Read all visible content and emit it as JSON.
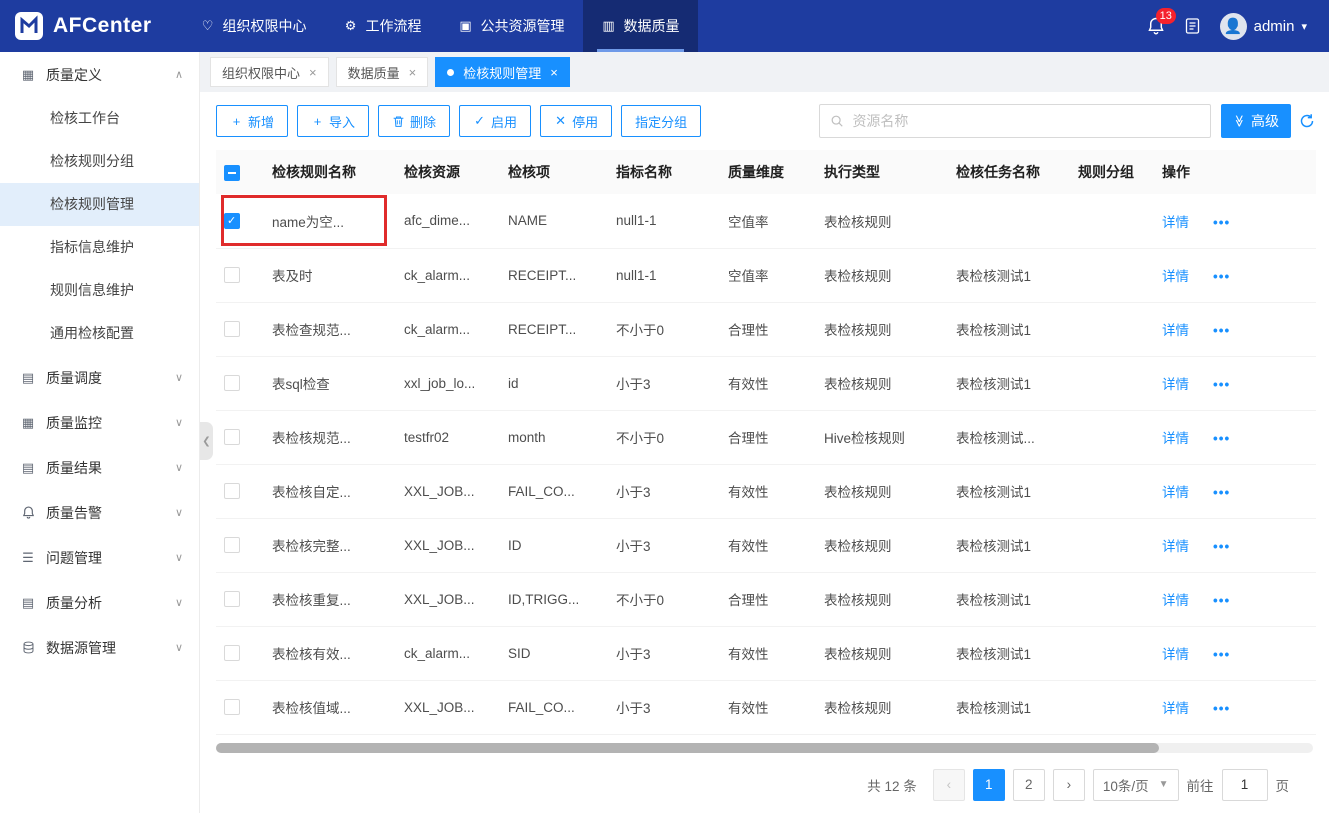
{
  "topbar": {
    "logo_text": "AFCenter",
    "nav_items": [
      {
        "label": "组织权限中心",
        "icon": "heart-icon",
        "active": false
      },
      {
        "label": "工作流程",
        "icon": "workflow-icon",
        "active": false
      },
      {
        "label": "公共资源管理",
        "icon": "resource-icon",
        "active": false
      },
      {
        "label": "数据质量",
        "icon": "chart-icon",
        "active": true
      }
    ],
    "notification_count": "13",
    "user_name": "admin"
  },
  "sidebar": {
    "groups": [
      {
        "label": "质量定义",
        "icon": "grid-icon",
        "expanded": true,
        "children": [
          {
            "label": "检核工作台",
            "active": false
          },
          {
            "label": "检核规则分组",
            "active": false
          },
          {
            "label": "检核规则管理",
            "active": true
          },
          {
            "label": "指标信息维护",
            "active": false
          },
          {
            "label": "规则信息维护",
            "active": false
          },
          {
            "label": "通用检核配置",
            "active": false
          }
        ]
      },
      {
        "label": "质量调度",
        "icon": "doc-icon",
        "expanded": false,
        "children": []
      },
      {
        "label": "质量监控",
        "icon": "grid-icon",
        "expanded": false,
        "children": []
      },
      {
        "label": "质量结果",
        "icon": "doc-icon",
        "expanded": false,
        "children": []
      },
      {
        "label": "质量告警",
        "icon": "bell-icon",
        "expanded": false,
        "children": []
      },
      {
        "label": "问题管理",
        "icon": "list-icon",
        "expanded": false,
        "children": []
      },
      {
        "label": "质量分析",
        "icon": "doc-icon",
        "expanded": false,
        "children": []
      },
      {
        "label": "数据源管理",
        "icon": "db-icon",
        "expanded": false,
        "children": []
      }
    ]
  },
  "tabs": [
    {
      "label": "组织权限中心",
      "active": false
    },
    {
      "label": "数据质量",
      "active": false
    },
    {
      "label": "检核规则管理",
      "active": true
    }
  ],
  "toolbar": {
    "buttons": [
      {
        "label": "新增",
        "icon": "plus-icon"
      },
      {
        "label": "导入",
        "icon": "plus-icon"
      },
      {
        "label": "删除",
        "icon": "trash-icon"
      },
      {
        "label": "启用",
        "icon": "check-icon"
      },
      {
        "label": "停用",
        "icon": "close-icon"
      },
      {
        "label": "指定分组",
        "icon": ""
      }
    ],
    "search_placeholder": "资源名称",
    "advanced_label": "高级"
  },
  "table": {
    "columns": [
      "检核规则名称",
      "检核资源",
      "检核项",
      "指标名称",
      "质量维度",
      "执行类型",
      "检核任务名称",
      "规则分组",
      "操作"
    ],
    "detail_label": "详情",
    "more_label": "•••",
    "rows": [
      {
        "checked": true,
        "name": "name为空...",
        "resource": "afc_dime...",
        "item": "NAME",
        "indicator": "null1-1",
        "dimension": "空值率",
        "exec_type": "表检核规则",
        "task": "",
        "group": ""
      },
      {
        "checked": false,
        "name": "表及时",
        "resource": "ck_alarm...",
        "item": "RECEIPT...",
        "indicator": "null1-1",
        "dimension": "空值率",
        "exec_type": "表检核规则",
        "task": "表检核测试1",
        "group": ""
      },
      {
        "checked": false,
        "name": "表检查规范...",
        "resource": "ck_alarm...",
        "item": "RECEIPT...",
        "indicator": "不小于0",
        "dimension": "合理性",
        "exec_type": "表检核规则",
        "task": "表检核测试1",
        "group": ""
      },
      {
        "checked": false,
        "name": "表sql检查",
        "resource": "xxl_job_lo...",
        "item": "id",
        "indicator": "小于3",
        "dimension": "有效性",
        "exec_type": "表检核规则",
        "task": "表检核测试1",
        "group": ""
      },
      {
        "checked": false,
        "name": "表检核规范...",
        "resource": "testfr02",
        "item": "month",
        "indicator": "不小于0",
        "dimension": "合理性",
        "exec_type": "Hive检核规则",
        "task": "表检核测试...",
        "group": ""
      },
      {
        "checked": false,
        "name": "表检核自定...",
        "resource": "XXL_JOB...",
        "item": "FAIL_CO...",
        "indicator": "小于3",
        "dimension": "有效性",
        "exec_type": "表检核规则",
        "task": "表检核测试1",
        "group": ""
      },
      {
        "checked": false,
        "name": "表检核完整...",
        "resource": "XXL_JOB...",
        "item": "ID",
        "indicator": "小于3",
        "dimension": "有效性",
        "exec_type": "表检核规则",
        "task": "表检核测试1",
        "group": ""
      },
      {
        "checked": false,
        "name": "表检核重复...",
        "resource": "XXL_JOB...",
        "item": "ID,TRIGG...",
        "indicator": "不小于0",
        "dimension": "合理性",
        "exec_type": "表检核规则",
        "task": "表检核测试1",
        "group": ""
      },
      {
        "checked": false,
        "name": "表检核有效...",
        "resource": "ck_alarm...",
        "item": "SID",
        "indicator": "小于3",
        "dimension": "有效性",
        "exec_type": "表检核规则",
        "task": "表检核测试1",
        "group": ""
      },
      {
        "checked": false,
        "name": "表检核值域...",
        "resource": "XXL_JOB...",
        "item": "FAIL_CO...",
        "indicator": "小于3",
        "dimension": "有效性",
        "exec_type": "表检核规则",
        "task": "表检核测试1",
        "group": ""
      }
    ]
  },
  "pagination": {
    "total_text": "共 12 条",
    "pages": [
      "1",
      "2"
    ],
    "active_page": "1",
    "page_size": "10条/页",
    "goto_label": "前往",
    "goto_value": "1",
    "page_unit": "页"
  },
  "colors": {
    "accent": "#1890ff",
    "topbar": "#1e3ca0",
    "badge": "#f5222d",
    "annotation": "#e02b2b"
  }
}
